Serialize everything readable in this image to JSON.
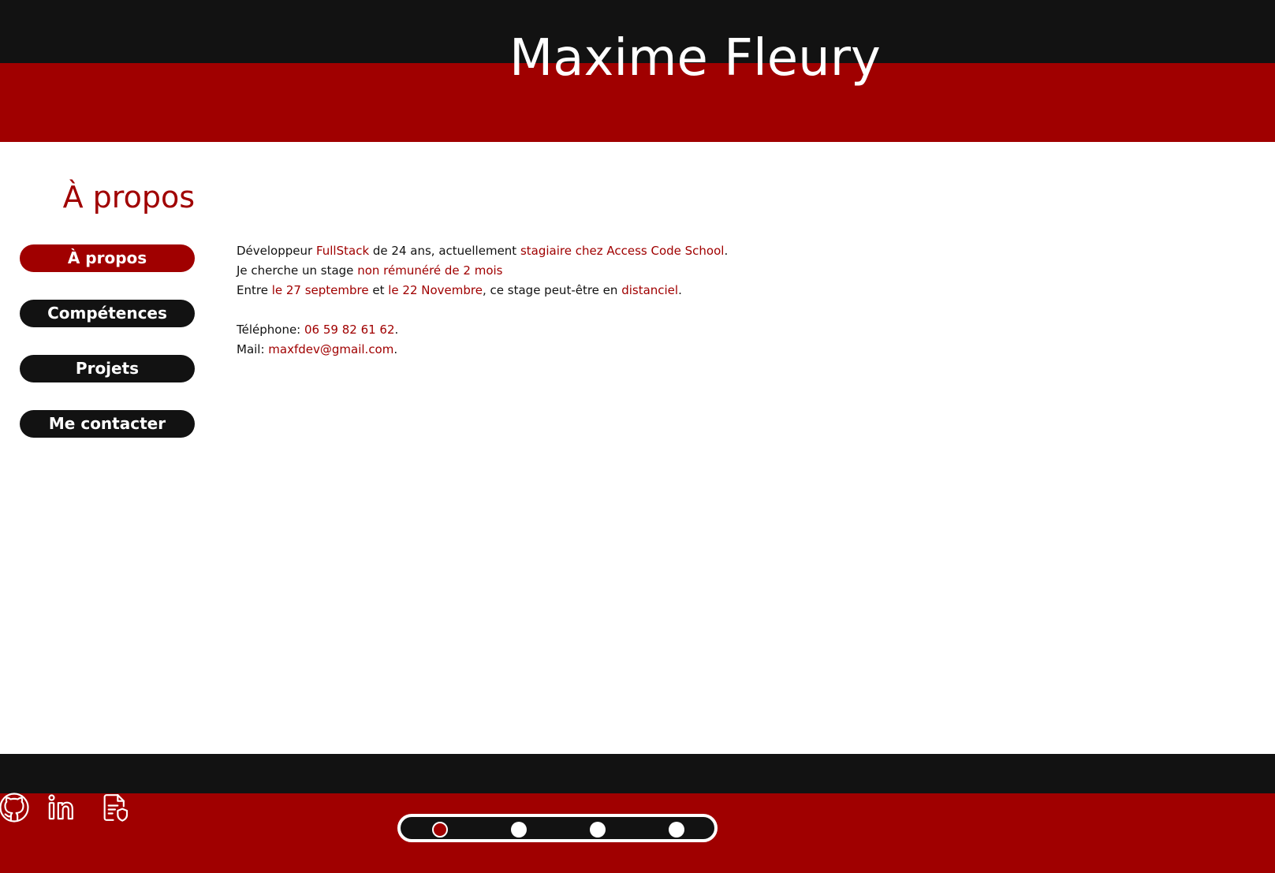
{
  "header": {
    "title": "Maxime Fleury"
  },
  "section": {
    "title": "À propos"
  },
  "nav": {
    "items": [
      {
        "label": "À propos",
        "active": true
      },
      {
        "label": "Compétences",
        "active": false
      },
      {
        "label": "Projets",
        "active": false
      },
      {
        "label": "Me contacter",
        "active": false
      }
    ]
  },
  "about": {
    "line1": {
      "t1": "Développeur ",
      "h1": "FullStack",
      "t2": " de 24 ans, actuellement ",
      "h2": "stagiaire chez Access Code School",
      "t3": "."
    },
    "line2": {
      "t1": "Je cherche un stage ",
      "h1": "non rémunéré de 2 mois"
    },
    "line3": {
      "t1": "Entre ",
      "h1": "le 27 septembre",
      "t2": " et ",
      "h2": "le 22 Novembre",
      "t3": ", ce stage peut-être en ",
      "h3": "distanciel",
      "t4": "."
    },
    "phone": {
      "label": "Téléphone: ",
      "value": "06 59 82 61 62",
      "end": "."
    },
    "mail": {
      "label": "Mail: ",
      "value": "maxfdev@gmail.com",
      "end": "."
    }
  },
  "footer": {
    "social": [
      {
        "name": "github-icon"
      },
      {
        "name": "linkedin-icon"
      },
      {
        "name": "cv-document-icon"
      }
    ],
    "pager": {
      "count": 4,
      "active_index": 0
    }
  },
  "colors": {
    "accent": "#a00000",
    "dark": "#121212",
    "background": "#ffffff"
  }
}
